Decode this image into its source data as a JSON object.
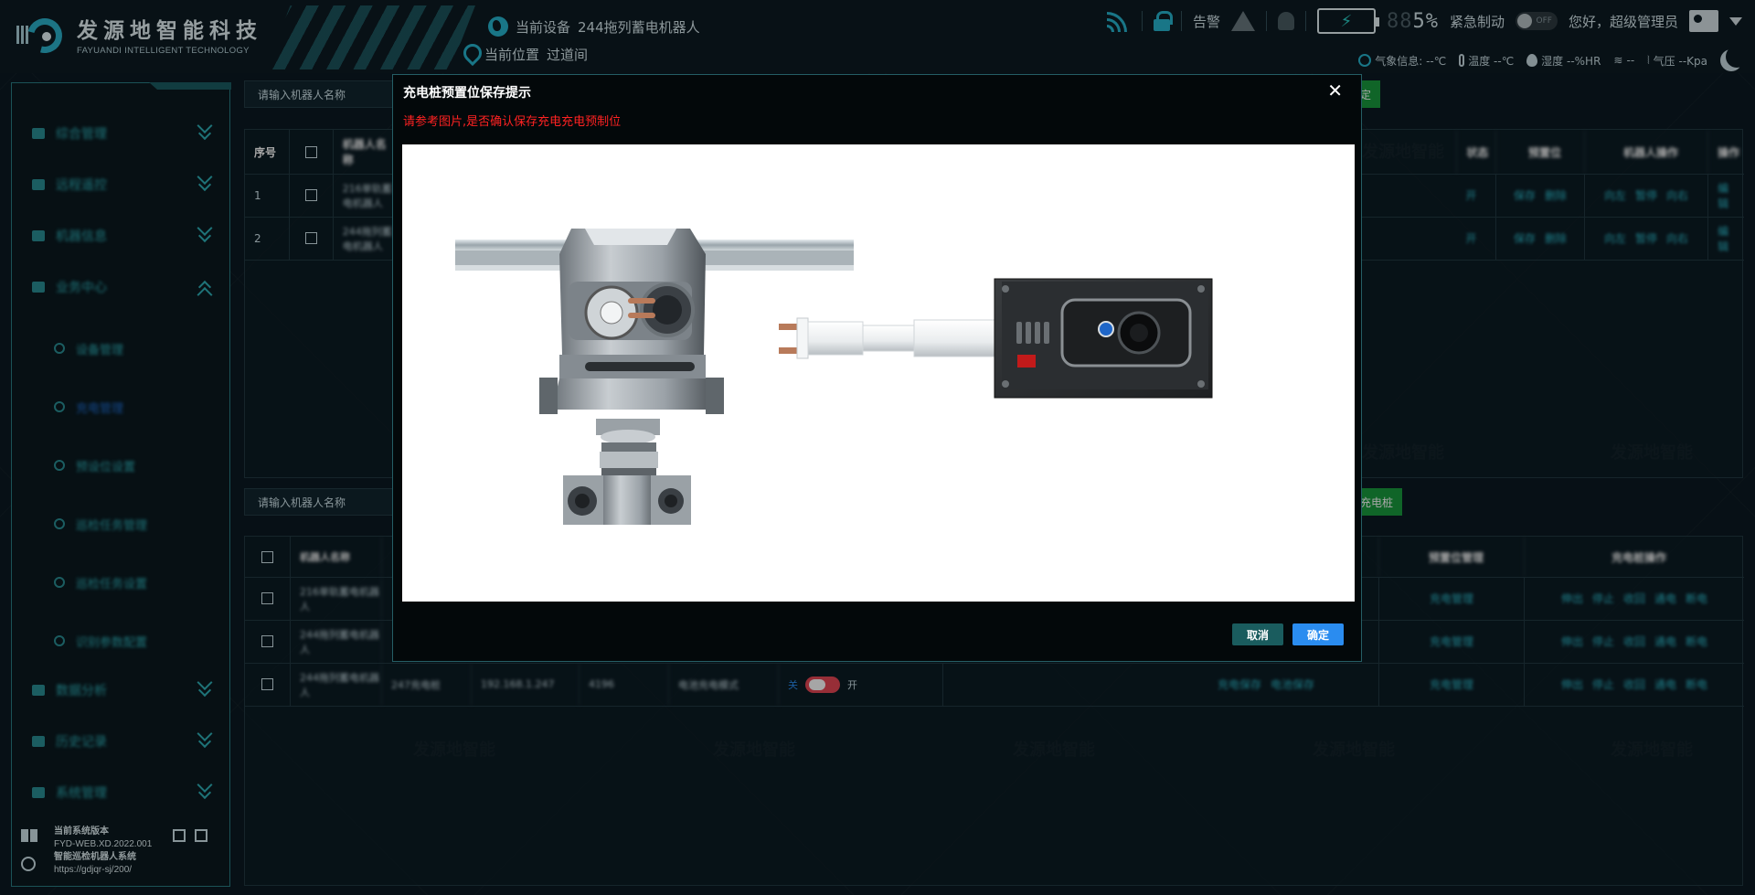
{
  "header": {
    "logo_cn": "发源地智能科技",
    "logo_en": "FAYUANDI INTELLIGENT TECHNOLOGY",
    "device_label": "当前设备",
    "device_name": "244拖列蓄电机器人",
    "location_label": "当前位置",
    "location_name": "过道间",
    "alarm_label": "告警",
    "battery_dim": "88",
    "battery_val": "5%",
    "estop_label": "紧急制动",
    "estop_toggle": "OFF",
    "greeting": "您好，超级管理员",
    "weather": {
      "info": "气象信息: --℃",
      "temp": "温度 --℃",
      "humidity": "湿度 --%HR",
      "wind": "--",
      "pressure": "气压 --Kpa"
    }
  },
  "sidebar": {
    "menus": [
      {
        "label": "综合管理"
      },
      {
        "label": "远程遥控"
      },
      {
        "label": "机器信息"
      },
      {
        "label": "业务中心"
      }
    ],
    "sub_items": [
      {
        "label": "设备管理"
      },
      {
        "label": "充电管理"
      },
      {
        "label": "预设位设置"
      },
      {
        "label": "巡检任务管理"
      },
      {
        "label": "巡检任务设置"
      },
      {
        "label": "识别参数配置"
      }
    ],
    "bottom_menus": [
      {
        "label": "数据分析"
      },
      {
        "label": "历史记录"
      },
      {
        "label": "系统管理"
      }
    ],
    "footer": {
      "version_label": "当前系统版本",
      "version": "FYD-WEB.XD.2022.001",
      "system_name": "智能巡检机器人系统",
      "url": "https://gdjqr-sj/200/"
    }
  },
  "top_panel": {
    "search_placeholder": "请输入机器人名称",
    "add_label": "定",
    "headers": [
      "序号",
      "机器人名称",
      "状态",
      "预置位",
      "机器人操作",
      "操作"
    ],
    "rows": [
      {
        "index": "1",
        "name": "216单轨蓄电机器人",
        "actions": [
          "保存",
          "删除"
        ],
        "moves": [
          "向左",
          "暂停",
          "向右"
        ],
        "edit": "编辑",
        "pre": "开"
      },
      {
        "index": "2",
        "name": "244拖列蓄电机器人",
        "actions": [
          "保存",
          "删除"
        ],
        "moves": [
          "向左",
          "暂停",
          "向右"
        ],
        "edit": "编辑",
        "pre": "开"
      }
    ]
  },
  "bottom_panel": {
    "search_placeholder": "请输入机器人名称",
    "add_label": "充电桩",
    "headers": [
      "机器人名称",
      "预置位管理",
      "充电桩操作"
    ],
    "rows": [
      {
        "name": "216单轨蓄电机器人",
        "pre": [
          "充电管理"
        ],
        "ops": [
          "伸出",
          "停止",
          "收回",
          "通电",
          "断电"
        ]
      },
      {
        "name": "244拖列蓄电机器人",
        "pre": [
          "充电管理"
        ],
        "ops": [
          "伸出",
          "停止",
          "收回",
          "通电",
          "断电"
        ]
      },
      {
        "name": "244拖列蓄电机器人",
        "pile": "247充电桩",
        "ip": "192.168.1.247",
        "port": "4196",
        "mode": "电池充电模式",
        "off_label": "关",
        "on_label": "开",
        "save": [
          "充电保存",
          "电池保存"
        ],
        "pre": [
          "充电管理"
        ],
        "ops": [
          "伸出",
          "停止",
          "收回",
          "通电",
          "断电"
        ]
      }
    ]
  },
  "watermark": "发源地智能",
  "modal": {
    "title": "充电桩预置位保存提示",
    "subtitle": "请参考图片,是否确认保存充电充电预制位",
    "close": "✕",
    "cancel": "取消",
    "confirm": "确定"
  }
}
